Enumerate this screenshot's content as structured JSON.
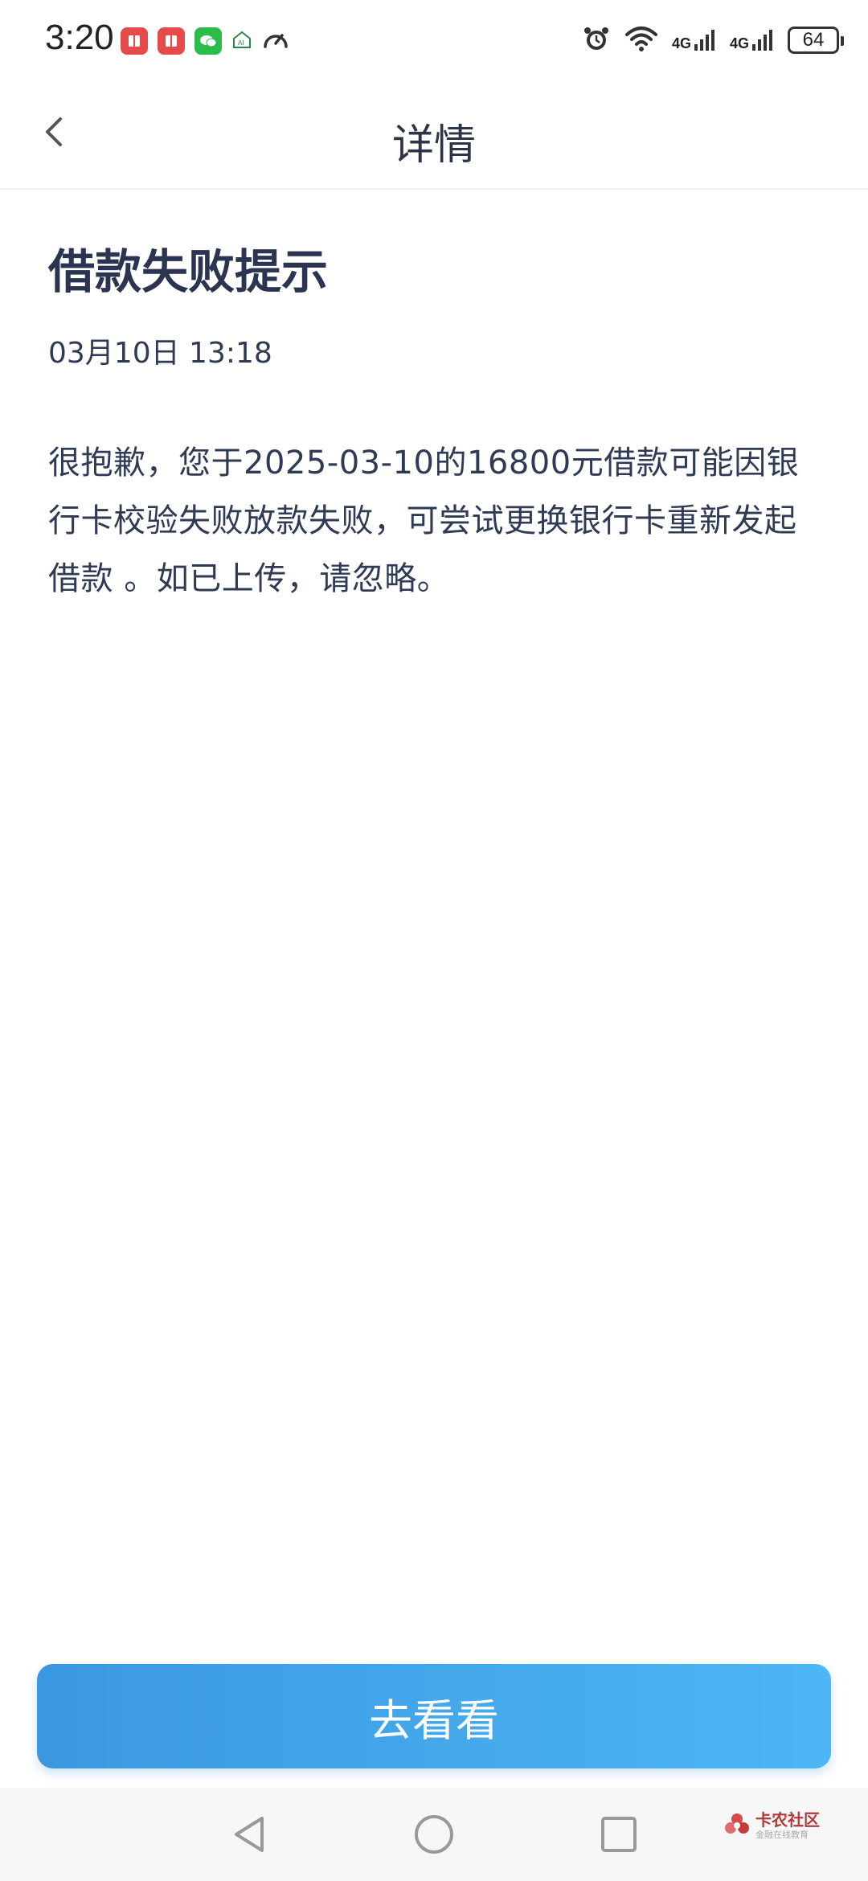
{
  "status_bar": {
    "time": "3:20",
    "network_1": "4G",
    "network_2": "4G",
    "battery": "64",
    "icons": [
      "app-red-icon",
      "app-red-icon",
      "wechat-icon",
      "home-ai-icon",
      "speed-icon",
      "alarm-icon",
      "wifi-icon",
      "signal-icon",
      "signal-icon",
      "battery-icon"
    ]
  },
  "header": {
    "title": "详情"
  },
  "message": {
    "title": "借款失败提示",
    "time": "03月10日 13:18",
    "body": "很抱歉，您于2025-03-10的16800元借款可能因银行卡校验失败放款失败，可尝试更换银行卡重新发起借款 。如已上传，请忽略。"
  },
  "action": {
    "button_label": "去看看"
  },
  "watermark": {
    "main": "卡农社区",
    "sub": "金融在线教育"
  },
  "colors": {
    "title": "#2b3450",
    "body": "#2f3a55",
    "button_start": "#3b98e0",
    "button_end": "#4db6f5"
  }
}
